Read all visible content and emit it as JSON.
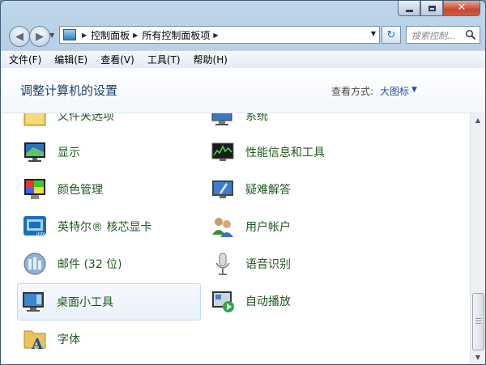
{
  "address_bar": {
    "crumbs": [
      "控制面板",
      "所有控制面板项"
    ],
    "search_placeholder": "搜索控制..."
  },
  "menu": {
    "items": [
      "文件(F)",
      "编辑(E)",
      "查看(V)",
      "工具(T)",
      "帮助(H)"
    ]
  },
  "header": {
    "title": "调整计算机的设置",
    "view_by_label": "查看方式:",
    "view_by_value": "大图标"
  },
  "items": [
    {
      "label": "文件夹选项",
      "icon": "folder-options-icon"
    },
    {
      "label": "系统",
      "icon": "system-icon"
    },
    {
      "label": "显示",
      "icon": "display-icon"
    },
    {
      "label": "性能信息和工具",
      "icon": "performance-icon"
    },
    {
      "label": "颜色管理",
      "icon": "color-management-icon"
    },
    {
      "label": "疑难解答",
      "icon": "troubleshooting-icon"
    },
    {
      "label": "英特尔® 核芯显卡",
      "icon": "intel-graphics-icon"
    },
    {
      "label": "用户帐户",
      "icon": "user-accounts-icon"
    },
    {
      "label": "邮件 (32 位)",
      "icon": "mail-icon"
    },
    {
      "label": "语音识别",
      "icon": "speech-recognition-icon"
    },
    {
      "label": "桌面小工具",
      "icon": "desktop-gadgets-icon"
    },
    {
      "label": "自动播放",
      "icon": "autoplay-icon"
    },
    {
      "label": "字体",
      "icon": "fonts-icon"
    }
  ],
  "colors": {
    "title": "#1e3f6e",
    "item_label": "#1e5b1e",
    "link": "#1e4fa5"
  }
}
